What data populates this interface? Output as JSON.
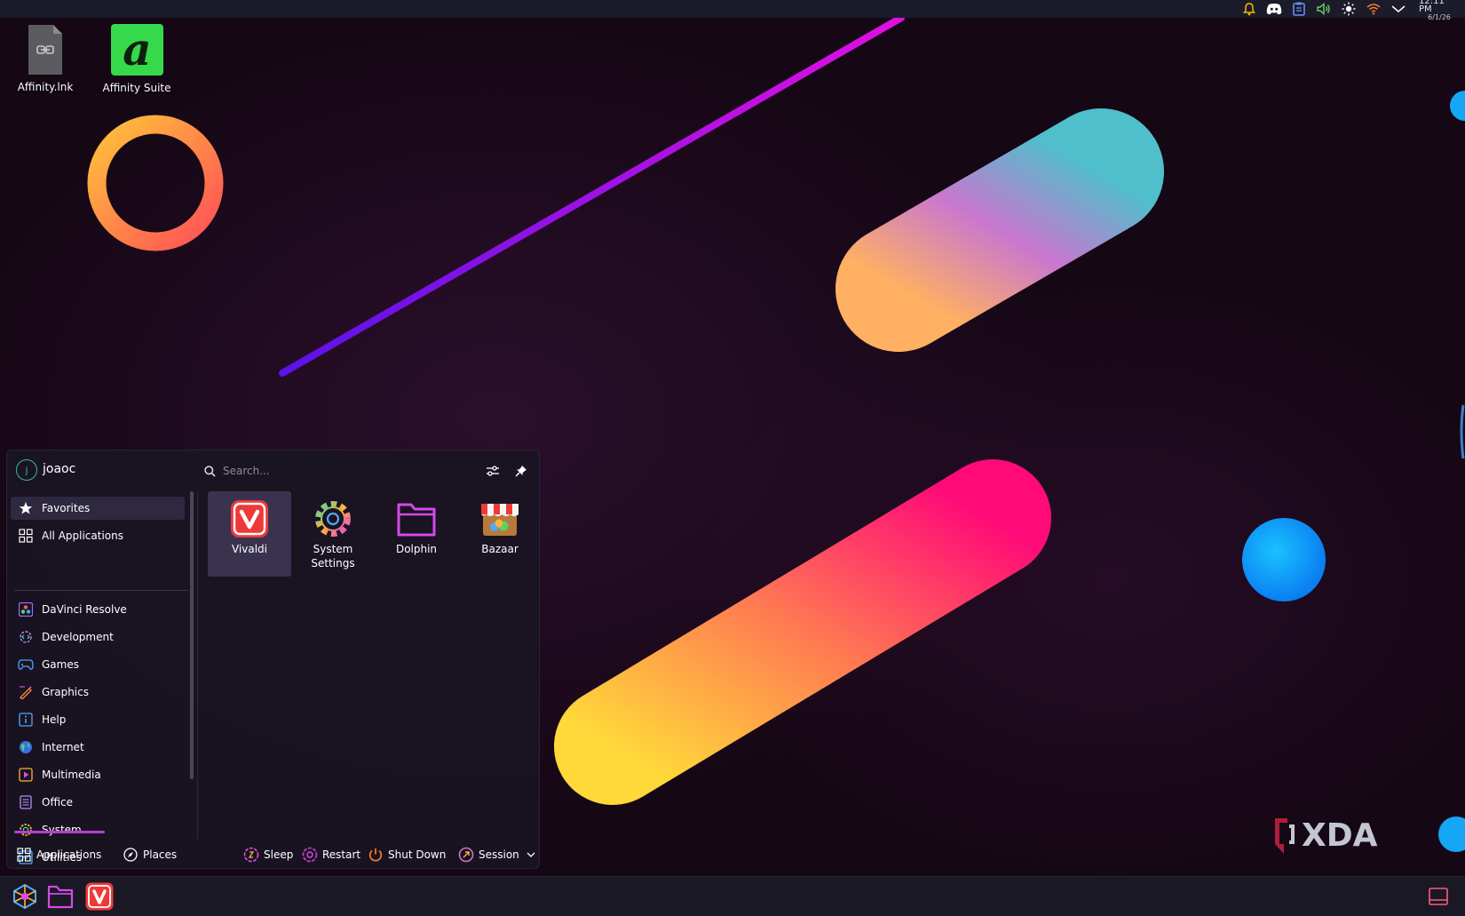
{
  "desktop": {
    "icons": [
      {
        "label": "Affinity.lnk",
        "icon": "shortcut-file-icon"
      },
      {
        "label": "Affinity Suite",
        "icon": "affinity-logo-icon"
      }
    ]
  },
  "top_panel": {
    "tray_icons": [
      "notification-bell-icon",
      "discord-icon",
      "clipboard-icon",
      "volume-icon",
      "brightness-icon",
      "wifi-icon",
      "chevron-down-icon"
    ],
    "clock_time": "12:11 PM",
    "clock_date": "6/1/26"
  },
  "launcher": {
    "user": {
      "name": "joaoc",
      "initial": "j"
    },
    "search": {
      "placeholder": "Search..."
    },
    "sidebar": {
      "favorites": "Favorites",
      "all_applications": "All Applications",
      "categories": [
        "DaVinci Resolve",
        "Development",
        "Games",
        "Graphics",
        "Help",
        "Internet",
        "Multimedia",
        "Office",
        "System",
        "Utilities"
      ]
    },
    "favorites": [
      {
        "label": "Vivaldi",
        "icon": "vivaldi-icon"
      },
      {
        "label": "System\nSettings",
        "icon": "settings-gear-icon"
      },
      {
        "label": "Dolphin",
        "icon": "folder-icon"
      },
      {
        "label": "Bazaar",
        "icon": "store-icon"
      }
    ],
    "footer": {
      "applications": "Applications",
      "places": "Places",
      "sleep": "Sleep",
      "restart": "Restart",
      "shut_down": "Shut Down",
      "session": "Session"
    }
  },
  "taskbar": {
    "items": [
      "app-launcher-icon",
      "file-manager-icon",
      "vivaldi-icon"
    ],
    "right": "show-desktop-icon"
  },
  "watermark": "XDA",
  "colors": {
    "accent": "#b63ed2",
    "panel": "#1a1824",
    "menu_bg": "#1a1422"
  }
}
